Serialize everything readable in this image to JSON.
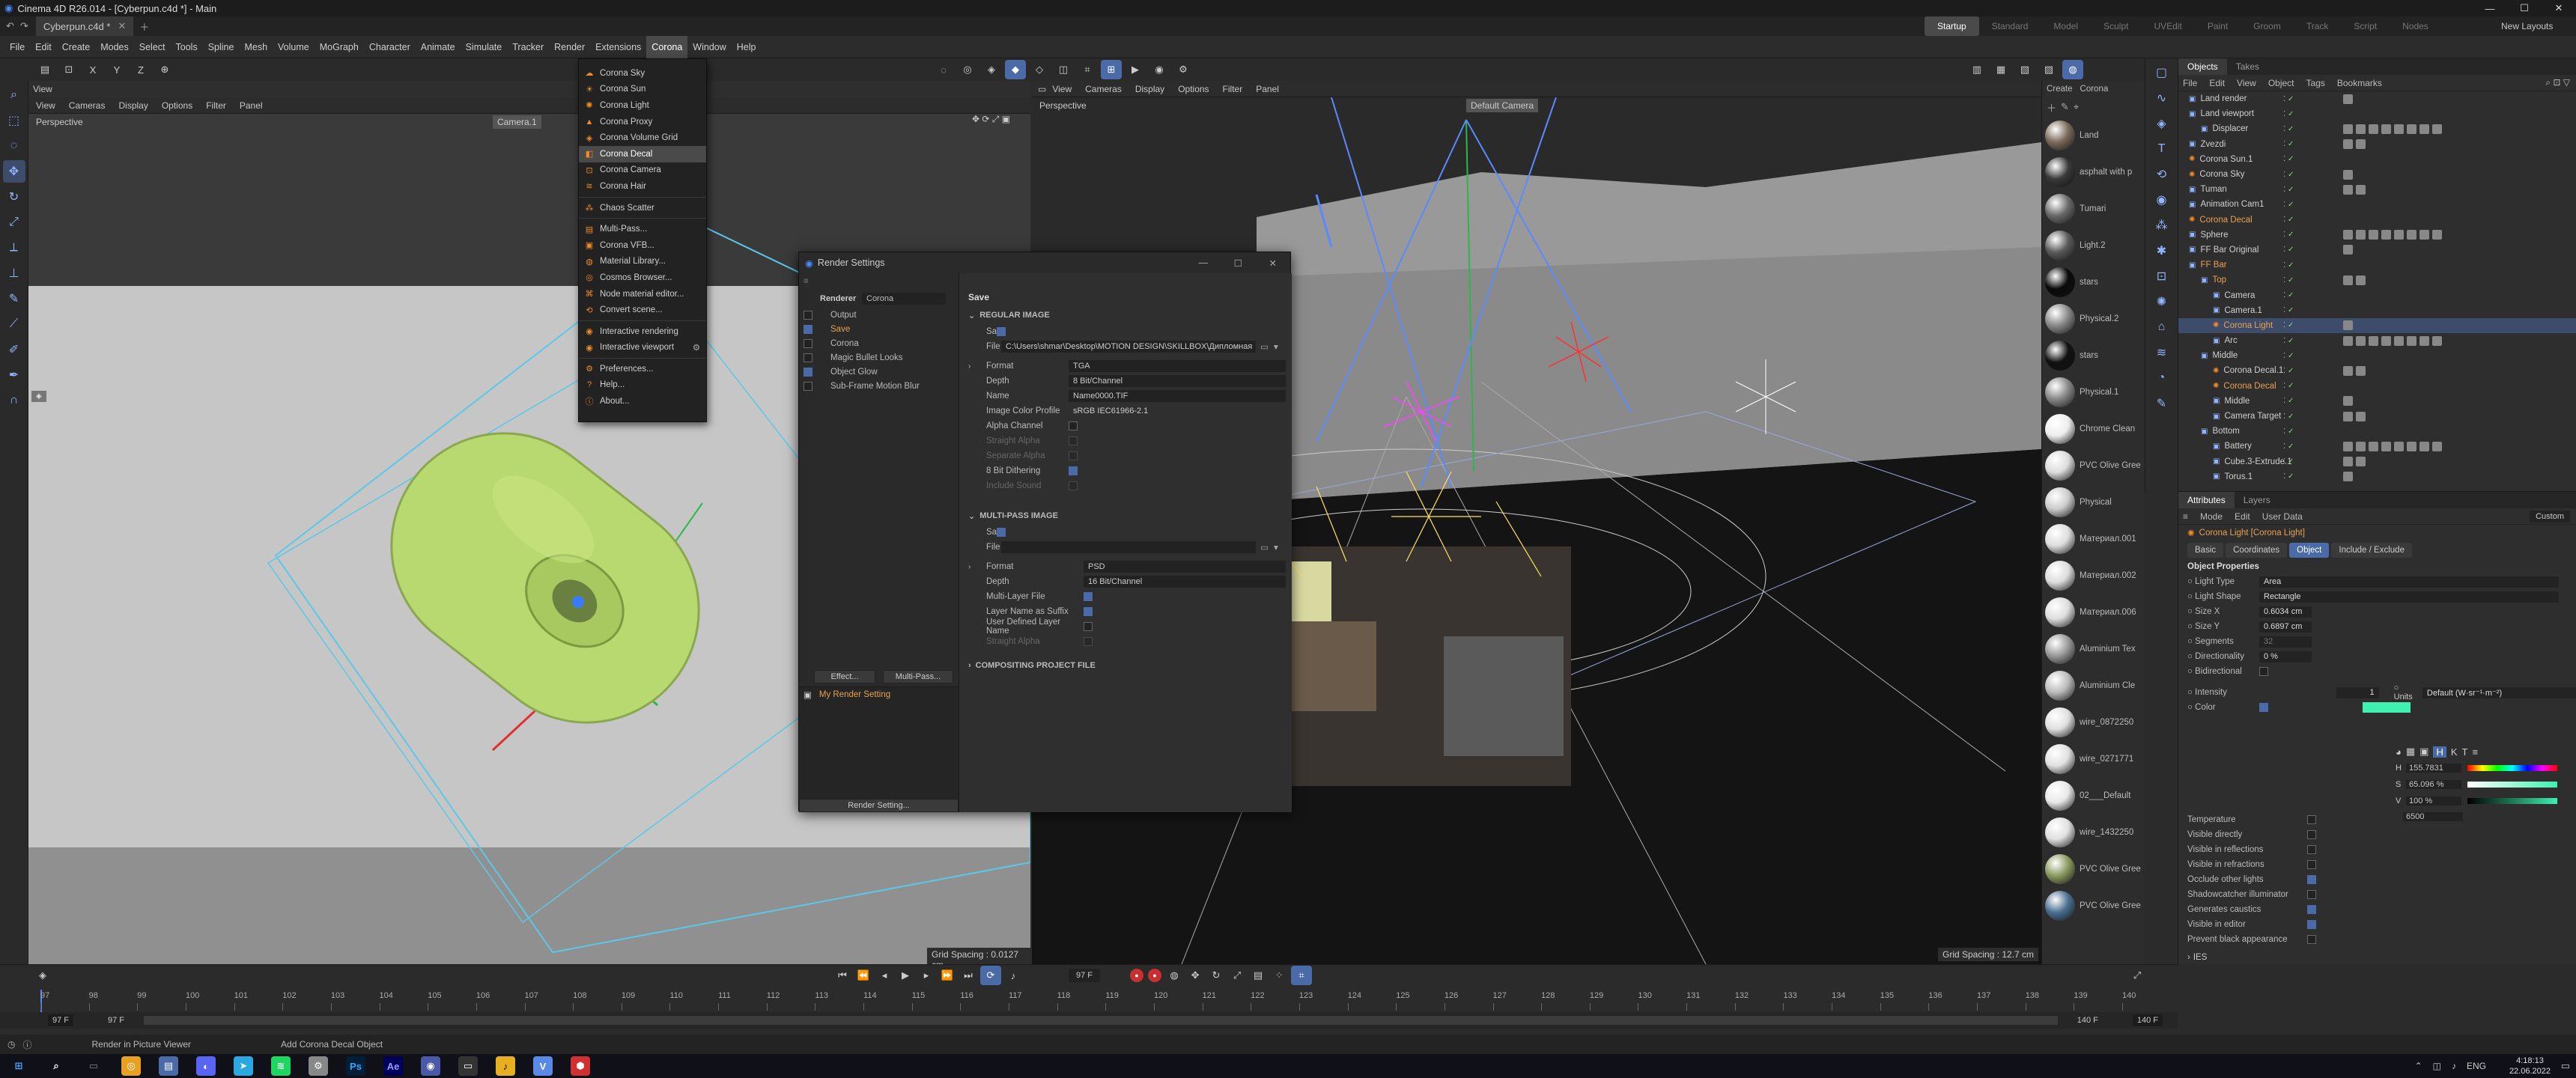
{
  "window": {
    "title": "Cinema 4D R26.014 - [Cyberpun.c4d *] - Main"
  },
  "file_tab": {
    "label": "Cyberpun.c4d *"
  },
  "layouts": [
    "Startup",
    "Standard",
    "Model",
    "Sculpt",
    "UVEdit",
    "Paint",
    "Groom",
    "Track",
    "Script",
    "Nodes"
  ],
  "new_layouts": "New Layouts",
  "menu": [
    "File",
    "Edit",
    "Create",
    "Modes",
    "Select",
    "Tools",
    "Spline",
    "Mesh",
    "Volume",
    "MoGraph",
    "Character",
    "Animate",
    "Simulate",
    "Tracker",
    "Render",
    "Extensions",
    "Corona",
    "Window",
    "Help"
  ],
  "corona_menu": [
    {
      "label": "Corona Sky",
      "hi": false
    },
    {
      "label": "Corona Sun",
      "hi": false
    },
    {
      "label": "Corona Light",
      "hi": false
    },
    {
      "label": "Corona Proxy",
      "hi": false
    },
    {
      "label": "Corona Volume Grid",
      "hi": false
    },
    {
      "label": "Corona Decal",
      "hi": true
    },
    {
      "label": "Corona Camera",
      "hi": false
    },
    {
      "label": "Corona Hair",
      "hi": false
    },
    {
      "sep": true
    },
    {
      "label": "Chaos Scatter"
    },
    {
      "sep": true
    },
    {
      "label": "Multi-Pass..."
    },
    {
      "label": "Corona VFB..."
    },
    {
      "label": "Material Library..."
    },
    {
      "label": "Cosmos Browser..."
    },
    {
      "label": "Node material editor..."
    },
    {
      "label": "Convert scene..."
    },
    {
      "sep": true
    },
    {
      "label": "Interactive rendering"
    },
    {
      "label": "Interactive viewport"
    },
    {
      "sep": true
    },
    {
      "label": "Preferences..."
    },
    {
      "label": "Help..."
    },
    {
      "label": "About..."
    }
  ],
  "vp1": {
    "header": "View",
    "menu": [
      "View",
      "Cameras",
      "Display",
      "Options",
      "Filter",
      "Panel"
    ],
    "label": "Perspective",
    "camera": "Camera.1",
    "grid": "Grid Spacing : 0.0127 cm"
  },
  "vp2": {
    "header": "View",
    "menu": [
      "View",
      "Cameras",
      "Display",
      "Options",
      "Filter",
      "Panel"
    ],
    "label": "Perspective",
    "camera": "Default Camera",
    "grid": "Grid Spacing : 12.7 cm"
  },
  "materials": [
    {
      "name": "Land",
      "c": "#7a6a5a"
    },
    {
      "name": "asphalt with p",
      "c": "#3a3a3a"
    },
    {
      "name": "Tumari",
      "c": "#6a6a6a"
    },
    {
      "name": "Light.2",
      "c": "#5a5a5a"
    },
    {
      "name": "stars",
      "c": "#0a0a0a"
    },
    {
      "name": "Physical.2",
      "c": "#888"
    },
    {
      "name": "stars",
      "c": "#111"
    },
    {
      "name": "Physical.1",
      "c": "#888"
    },
    {
      "name": "Chrome Clean",
      "c": "#eee"
    },
    {
      "name": "PVC Olive Gree",
      "c": "#dcdcdc"
    },
    {
      "name": "Physical",
      "c": "#ccc"
    },
    {
      "name": "Материал.001",
      "c": "#ddd"
    },
    {
      "name": "Материал.002",
      "c": "#ddd"
    },
    {
      "name": "Материал.006",
      "c": "#ddd"
    },
    {
      "name": "Aluminium Tex",
      "c": "#999"
    },
    {
      "name": "Aluminium Cle",
      "c": "#bbb"
    },
    {
      "name": "wire_0872250",
      "c": "#e0e0e0"
    },
    {
      "name": "wire_0271771",
      "c": "#e0e0e0"
    },
    {
      "name": "02___Default",
      "c": "#e8e8e8"
    },
    {
      "name": "wire_1432250",
      "c": "#e0e0e0"
    },
    {
      "name": "PVC Olive Gree",
      "c": "#8a9a60"
    },
    {
      "name": "PVC Olive Gree",
      "c": "#4a7090"
    }
  ],
  "objects_tabs": [
    "Objects",
    "Takes"
  ],
  "objects_menu": [
    "File",
    "Edit",
    "View",
    "Object",
    "Tags",
    "Bookmarks"
  ],
  "objects": [
    {
      "name": "Land render",
      "d": 0
    },
    {
      "name": "Land viewport",
      "d": 0
    },
    {
      "name": "Displacer",
      "d": 1
    },
    {
      "name": "Zvezdi",
      "d": 0
    },
    {
      "name": "Corona Sun.1",
      "d": 0
    },
    {
      "name": "Corona Sky",
      "d": 0
    },
    {
      "name": "Tuman",
      "d": 0
    },
    {
      "name": "Animation Cam1",
      "d": 0
    },
    {
      "name": "Corona Decal",
      "d": 0
    },
    {
      "name": "Sphere",
      "d": 0
    },
    {
      "name": "FF Bar Original",
      "d": 0
    },
    {
      "name": "FF Bar",
      "d": 0
    },
    {
      "name": "Top",
      "d": 1
    },
    {
      "name": "Camera",
      "d": 2
    },
    {
      "name": "Camera.1",
      "d": 2
    },
    {
      "name": "Corona Light",
      "d": 2,
      "sel": true
    },
    {
      "name": "Arc",
      "d": 2
    },
    {
      "name": "Middle",
      "d": 1
    },
    {
      "name": "Corona Decal.1",
      "d": 2
    },
    {
      "name": "Corona Decal",
      "d": 2
    },
    {
      "name": "Middle",
      "d": 2
    },
    {
      "name": "Camera Target",
      "d": 2
    },
    {
      "name": "Bottom",
      "d": 1
    },
    {
      "name": "Battery",
      "d": 2
    },
    {
      "name": "Cube.3-Extrude.1",
      "d": 2
    },
    {
      "name": "Torus.1",
      "d": 2
    }
  ],
  "attr": {
    "tabs": [
      "Attributes",
      "Layers"
    ],
    "menu": [
      "Mode",
      "Edit",
      "User Data"
    ],
    "custom": "Custom",
    "object_title": "Corona Light [Corona Light]",
    "btabs": [
      "Basic",
      "Coordinates",
      "Object",
      "Include / Exclude"
    ],
    "section": "Object Properties",
    "light_type": "Area",
    "light_shape": "Rectangle",
    "size_x": "0.6034 cm",
    "size_y": "0.6897 cm",
    "segments": "32",
    "directionality": "0 %",
    "intensity": "1",
    "units": "Default (W·sr⁻¹·m⁻²)",
    "h": "155.7831",
    "s": "65.096 %",
    "v": "100 %",
    "temp": "6500",
    "checks": [
      "Temperature",
      "Visible directly",
      "Visible in reflections",
      "Visible in refractions",
      "Occlude other lights",
      "Shadowcatcher illuminator",
      "Generates caustics",
      "Visible in editor",
      "Prevent black appearance"
    ],
    "ies": "IES"
  },
  "render_settings": {
    "title": "Render Settings",
    "renderer_label": "Renderer",
    "renderer": "Corona",
    "left": [
      {
        "label": "Output",
        "cb": false
      },
      {
        "label": "Save",
        "cb": true,
        "hi": true
      },
      {
        "label": "Corona",
        "cb": false
      },
      {
        "label": "Magic Bullet Looks",
        "cb": false
      },
      {
        "label": "Object Glow",
        "cb": true
      },
      {
        "label": "Sub-Frame Motion Blur",
        "cb": false
      }
    ],
    "effect": "Effect...",
    "multipass": "Multi-Pass...",
    "my_render": "My Render Setting",
    "bottom_btn": "Render Setting...",
    "save_title": "Save",
    "regular": "REGULAR IMAGE",
    "save": "Save",
    "file": "File",
    "file_path": "C:\\Users\\shmar\\Desktop\\MOTION DESIGN\\SKILLBOX\\Дипломная",
    "format": "Format",
    "format_val": "TGA",
    "depth": "Depth",
    "depth_val": "8 Bit/Channel",
    "name": "Name",
    "name_val": "Name0000.TIF",
    "profile": "Image Color Profile",
    "profile_val": "sRGB IEC61966-2.1",
    "alpha": "Alpha Channel",
    "straight": "Straight Alpha",
    "separate": "Separate Alpha",
    "dither": "8 Bit Dithering",
    "include": "Include Sound",
    "multi": "MULTI-PASS IMAGE",
    "mformat_val": "PSD",
    "mdepth_val": "16 Bit/Channel",
    "mlayer": "Multi-Layer File",
    "lsuffix": "Layer Name as Suffix",
    "udef": "User Defined Layer Name",
    "malpha": "Straight Alpha",
    "compositing": "COMPOSITING PROJECT FILE"
  },
  "timeline": {
    "frame": "97 F",
    "start": "97 F",
    "start2": "97 F",
    "end": "140 F",
    "end2": "140 F",
    "ticks": [
      "97",
      "98",
      "99",
      "100",
      "101",
      "102",
      "103",
      "104",
      "105",
      "106",
      "107",
      "108",
      "109",
      "110",
      "111",
      "112",
      "113",
      "114",
      "115",
      "116",
      "117",
      "118",
      "119",
      "120",
      "121",
      "122",
      "123",
      "124",
      "125",
      "126",
      "127",
      "128",
      "129",
      "130",
      "131",
      "132",
      "133",
      "134",
      "135",
      "136",
      "137",
      "138",
      "139",
      "140"
    ]
  },
  "status": {
    "left": "Render in Picture Viewer",
    "mid": "Add Corona Decal Object"
  },
  "clock": {
    "time": "4:18:13",
    "date": "22.06.2022",
    "lang": "ENG"
  }
}
